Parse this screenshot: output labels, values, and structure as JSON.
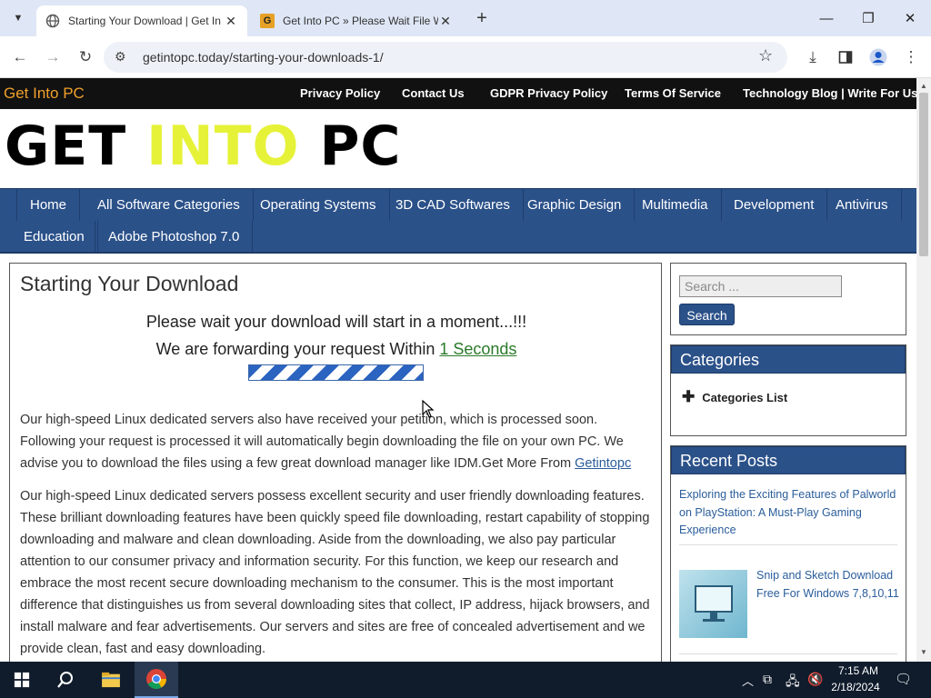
{
  "browser": {
    "tabs": [
      {
        "title": "Starting Your Download | Get In",
        "active": true
      },
      {
        "title": "Get Into PC » Please Wait File W",
        "active": false
      }
    ],
    "new_tab": "+",
    "url": "getintopc.today/starting-your-downloads-1/"
  },
  "site": {
    "brand_small": "Get Into PC",
    "top_links": [
      "Privacy Policy",
      "Contact Us",
      "GDPR Privacy Policy",
      "Terms Of Service",
      "Technology Blog | Write For Us"
    ],
    "logo": {
      "w1": "GET",
      "w2": "INTO",
      "w3": "PC"
    },
    "nav_row1": [
      "Home",
      "All Software Categories",
      "Operating Systems",
      "3D CAD Softwares",
      "Graphic Design",
      "Multimedia",
      "Development",
      "Antivirus"
    ],
    "nav_row2": [
      "Education",
      "Adobe Photoshop 7.0"
    ]
  },
  "content": {
    "title": "Starting Your Download",
    "wait_line": "Please wait your download will start in a moment...!!!",
    "forward_prefix": "We are forwarding your request Within ",
    "forward_link": "1 Seconds",
    "para1": "Our high-speed Linux dedicated servers also have received your petition, which is processed soon. Following your request is processed it will automatically begin downloading the file on your own PC. We advise you to download the files using a few great download manager like IDM.Get More From ",
    "para1_link": "Getintopc",
    "para2": "Our high-speed Linux dedicated servers possess excellent security and user friendly downloading features. These brilliant downloading features have been quickly speed file downloading, restart capability of stopping downloading and malware and clean downloading. Aside from the downloading, we also pay particular attention to our consumer privacy and information security. For this function, we keep our research and embrace the most recent secure downloading mechanism to the consumer. This is the most important difference that distinguishes us from several downloading sites that collect, IP address, hijack browsers, and install malware and fear advertisements. Our servers and sites are free of concealed advertisement and we provide clean, fast and easy downloading."
  },
  "sidebar": {
    "search_placeholder": "Search ...",
    "search_button": "Search",
    "categories_title": "Categories",
    "categories_item": "Categories List",
    "recent_title": "Recent Posts",
    "post1": "Exploring the Exciting Features of Palworld on PlayStation: A Must-Play Gaming Experience",
    "post2": "Snip and Sketch Download Free For Windows 7,8,10,11"
  },
  "taskbar": {
    "time": "7:15 AM",
    "date": "2/18/2024"
  },
  "colors": {
    "nav_blue": "#2b5189",
    "brand_orange": "#f0a02c",
    "logo_yellow": "#e6f238"
  }
}
